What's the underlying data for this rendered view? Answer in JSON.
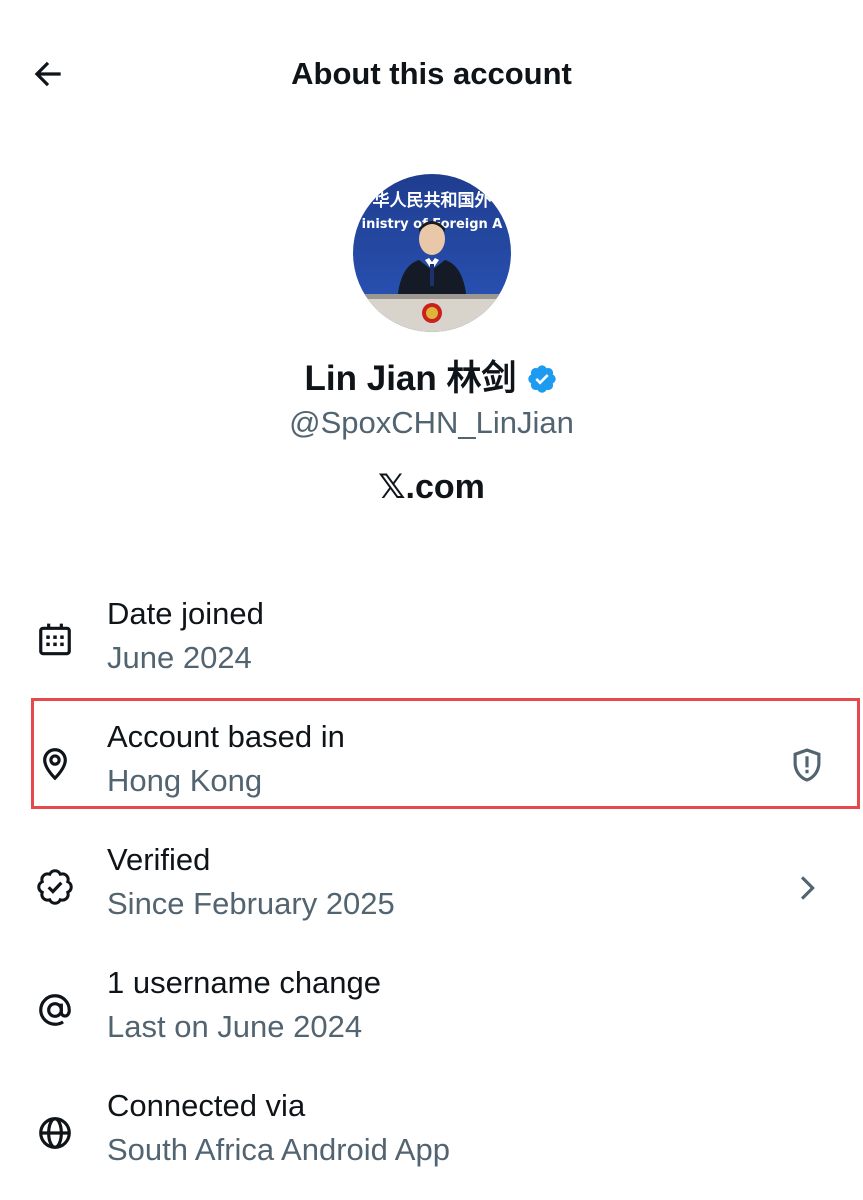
{
  "header": {
    "back_icon": "arrow-left-icon",
    "title": "About this account"
  },
  "profile": {
    "avatar_icon": "profile-photo",
    "name": "Lin Jian 林剑",
    "verified_icon": "verified-badge-icon",
    "handle": "@SpoxCHN_LinJian",
    "website": "𝕏.com",
    "avatar_banner_text": "华人民共和国外",
    "avatar_banner_subtext": "inistry of Foreign A"
  },
  "rows": [
    {
      "icon": "calendar-icon",
      "title": "Date joined",
      "subtitle": "June 2024"
    },
    {
      "icon": "location-pin-icon",
      "title": "Account based in",
      "subtitle": "Hong Kong",
      "trailing_icon": "shield-alert-icon"
    },
    {
      "icon": "verified-check-icon",
      "title": "Verified",
      "subtitle": "Since February 2025",
      "trailing_icon": "chevron-right-icon"
    },
    {
      "icon": "at-sign-icon",
      "title": "1 username change",
      "subtitle": "Last on June 2024"
    },
    {
      "icon": "globe-icon",
      "title": "Connected via",
      "subtitle": "South Africa Android App"
    }
  ],
  "colors": {
    "text_primary": "#0f1419",
    "text_secondary": "#536471",
    "verified_blue": "#1d9bf0",
    "highlight_red": "#e5484d"
  }
}
